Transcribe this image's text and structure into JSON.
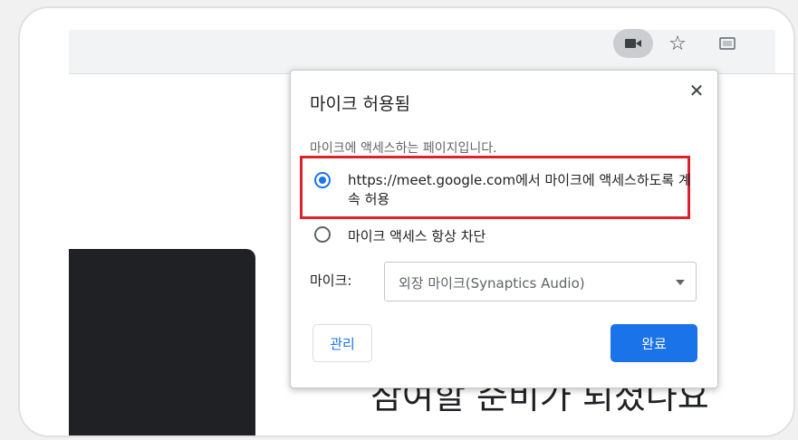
{
  "browser": {
    "camera_icon": "video-camera-icon",
    "star_icon": "star-icon",
    "extension_icon": "extension-icon",
    "star_glyph": "☆"
  },
  "page": {
    "join_heading": "참여할 준비가 되셨나요"
  },
  "popup": {
    "title": "마이크 허용됨",
    "close_glyph": "✕",
    "subtitle": "마이크에 액세스하는 페이지입니다.",
    "options": [
      {
        "label": "https://meet.google.com에서 마이크에 액세스하도록 계속 허용",
        "selected": true
      },
      {
        "label": "마이크 액세스 항상 차단",
        "selected": false
      }
    ],
    "mic_label": "마이크:",
    "mic_selected": "외장 마이크(Synaptics Audio)",
    "manage_label": "관리",
    "done_label": "완료"
  },
  "colors": {
    "accent": "#1a73e8",
    "highlight": "#e0212a"
  }
}
